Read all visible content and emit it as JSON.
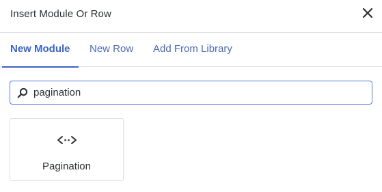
{
  "modal": {
    "title": "Insert Module Or Row"
  },
  "tabs": [
    {
      "label": "New Module",
      "active": true
    },
    {
      "label": "New Row",
      "active": false
    },
    {
      "label": "Add From Library",
      "active": false
    }
  ],
  "search": {
    "value": "pagination",
    "icon": "search-icon"
  },
  "results": [
    {
      "label": "Pagination",
      "icon": "code-arrows-icon"
    }
  ],
  "colors": {
    "accent": "#3b63c4",
    "tab_text": "#4a6bb5",
    "border": "#dcdfe3",
    "input_focus_border": "#4e7bd6",
    "text": "#2b2f33"
  }
}
